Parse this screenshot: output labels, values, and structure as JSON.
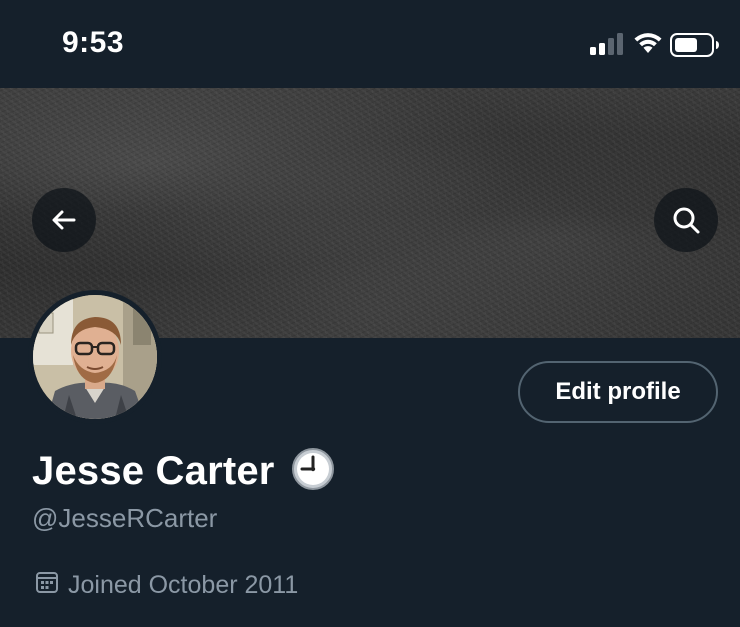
{
  "status_bar": {
    "time": "9:53"
  },
  "header": {
    "back_icon": "arrow-left-icon",
    "search_icon": "search-icon"
  },
  "profile": {
    "display_name": "Jesse Carter",
    "status_emoji": "clock-emoji",
    "handle": "@JesseRCarter",
    "joined": "Joined October 2011",
    "edit_profile_label": "Edit profile"
  },
  "colors": {
    "background": "#15202b",
    "secondary_text": "#8b98a5",
    "button_border": "#536471"
  }
}
